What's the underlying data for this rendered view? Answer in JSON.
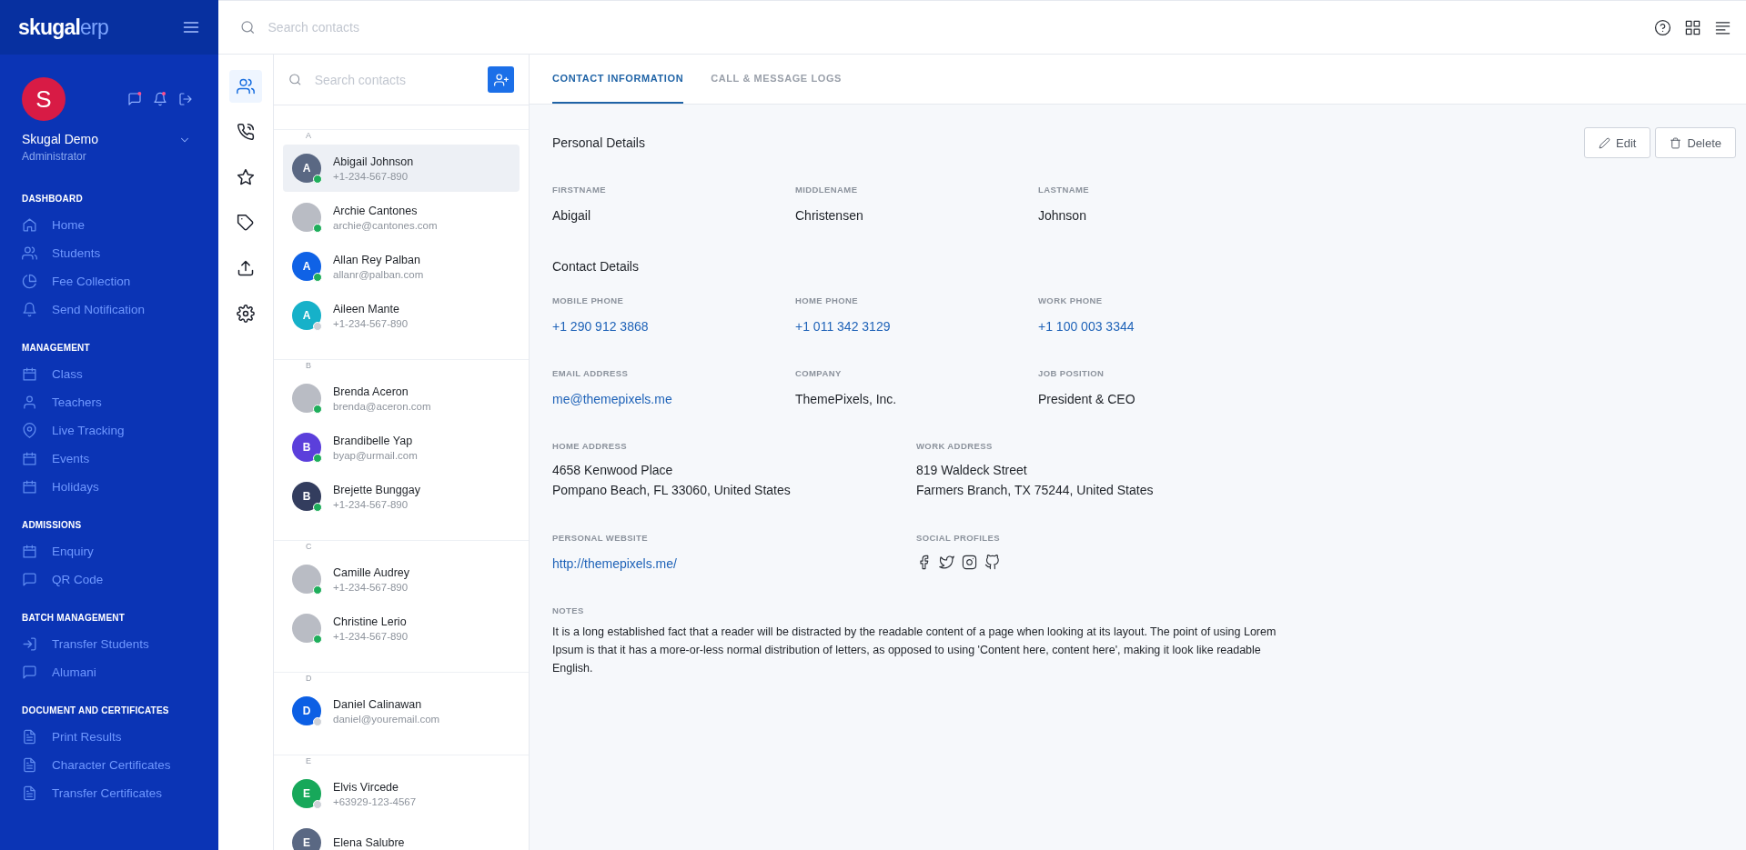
{
  "brand": {
    "logo": "**skugal**erp"
  },
  "user": {
    "initial": "S",
    "name": "Skugal Demo",
    "role": "Administrator"
  },
  "nav": [
    {
      "title": "DASHBOARD",
      "items": [
        "Home",
        "Students",
        "Fee Collection",
        "Send Notification"
      ]
    },
    {
      "title": "MANAGEMENT",
      "items": [
        "Class",
        "Teachers",
        "Live Tracking",
        "Events",
        "Holidays"
      ]
    },
    {
      "title": "ADMISSIONS",
      "items": [
        "Enquiry",
        "QR Code"
      ]
    },
    {
      "title": "BATCH MANAGEMENT",
      "items": [
        "Transfer Students",
        "Alumani"
      ]
    },
    {
      "title": "DOCUMENT AND CERTIFICATES",
      "items": [
        "Print Results",
        "Character Certificates",
        "Transfer Certificates"
      ]
    }
  ],
  "topbar": {
    "search": {
      "placeholder": "Search contacts"
    }
  },
  "rail": [
    {
      "selected": true
    },
    {
      "selected": false
    },
    {
      "selected": false
    },
    {
      "selected": false
    },
    {
      "selected": false
    },
    {
      "selected": false
    }
  ],
  "contacts": {
    "search": {
      "placeholder": "Search contacts"
    },
    "groups": [
      {
        "letter": "A",
        "contacts": [
          {
            "name": "Abigail Johnson",
            "sub": "+1-234-567-890",
            "selected": true,
            "online": true,
            "avatar": {
              "kind": "initial",
              "text": "A",
              "color": "#5a6883"
            }
          },
          {
            "name": "Archie Cantones",
            "sub": "archie@cantones.com",
            "selected": false,
            "online": true,
            "avatar": {
              "kind": "photo"
            }
          },
          {
            "name": "Allan Rey Palban",
            "sub": "allanr@palban.com",
            "selected": false,
            "online": true,
            "avatar": {
              "kind": "initial",
              "text": "A",
              "color": "#0f62e6"
            }
          },
          {
            "name": "Aileen Mante",
            "sub": "+1-234-567-890",
            "selected": false,
            "online": false,
            "avatar": {
              "kind": "initial",
              "text": "A",
              "color": "#16b1c9"
            }
          }
        ]
      },
      {
        "letter": "B",
        "contacts": [
          {
            "name": "Brenda Aceron",
            "sub": "brenda@aceron.com",
            "selected": false,
            "online": true,
            "avatar": {
              "kind": "photo"
            }
          },
          {
            "name": "Brandibelle Yap",
            "sub": "byap@urmail.com",
            "selected": false,
            "online": true,
            "avatar": {
              "kind": "initial",
              "text": "B",
              "color": "#5b3fdb"
            }
          },
          {
            "name": "Brejette Bunggay",
            "sub": "+1-234-567-890",
            "selected": false,
            "online": true,
            "avatar": {
              "kind": "initial",
              "text": "B",
              "color": "#333d5e"
            }
          }
        ]
      },
      {
        "letter": "C",
        "contacts": [
          {
            "name": "Camille Audrey",
            "sub": "+1-234-567-890",
            "selected": false,
            "online": true,
            "avatar": {
              "kind": "photo"
            }
          },
          {
            "name": "Christine Lerio",
            "sub": "+1-234-567-890",
            "selected": false,
            "online": true,
            "avatar": {
              "kind": "photo"
            }
          }
        ]
      },
      {
        "letter": "D",
        "contacts": [
          {
            "name": "Daniel Calinawan",
            "sub": "daniel@youremail.com",
            "selected": false,
            "online": false,
            "avatar": {
              "kind": "initial",
              "text": "D",
              "color": "#0c5fe4"
            }
          }
        ]
      },
      {
        "letter": "E",
        "contacts": [
          {
            "name": "Elvis Vircede",
            "sub": "+63929-123-4567",
            "selected": false,
            "online": false,
            "avatar": {
              "kind": "initial",
              "text": "E",
              "color": "#17a85a"
            }
          },
          {
            "name": "Elena Salubre",
            "selected": false,
            "avatar": {
              "kind": "initial",
              "text": "E",
              "color": "#5a6883"
            }
          }
        ]
      }
    ]
  },
  "detail": {
    "tabs": [
      {
        "label": "CONTACT INFORMATION",
        "selected": true
      },
      {
        "label": "CALL & MESSAGE LOGS",
        "selected": false
      }
    ],
    "buttons": [
      {
        "label": "Edit",
        "kind": "edit"
      },
      {
        "label": "Delete",
        "kind": "delete"
      }
    ],
    "sections": [
      {
        "title": "Personal Details",
        "rows": [
          {
            "fields": [
              {
                "label": "FIRSTNAME",
                "kind": "text",
                "value": "Abigail"
              },
              {
                "label": "MIDDLENAME",
                "kind": "text",
                "value": "Christensen"
              },
              {
                "label": "LASTNAME",
                "kind": "text",
                "value": "Johnson"
              }
            ]
          }
        ]
      },
      {
        "title": "Contact Details",
        "rows": [
          {
            "fields": [
              {
                "label": "MOBILE PHONE",
                "kind": "link",
                "value": "+1 290 912 3868"
              },
              {
                "label": "HOME PHONE",
                "kind": "link",
                "value": "+1 011 342 3129"
              },
              {
                "label": "WORK PHONE",
                "kind": "link",
                "value": "+1 100 003 3344"
              }
            ]
          },
          {
            "fields": [
              {
                "label": "EMAIL ADDRESS",
                "kind": "link",
                "value": "me@themepixels.me"
              },
              {
                "label": "COMPANY",
                "kind": "text",
                "value": "ThemePixels, Inc."
              },
              {
                "label": "JOB POSITION",
                "kind": "text",
                "value": "President & CEO"
              }
            ]
          },
          {
            "fields": [
              {
                "label": "HOME ADDRESS",
                "kind": "lines",
                "lines": [
                  "4658 Kenwood Place",
                  "Pompano Beach, FL 33060, United States"
                ]
              },
              {
                "label": "WORK ADDRESS",
                "kind": "lines",
                "lines": [
                  "819 Waldeck Street",
                  "Farmers Branch, TX 75244, United States"
                ]
              }
            ]
          },
          {
            "fields": [
              {
                "label": "PERSONAL WEBSITE",
                "kind": "link",
                "value": "http://themepixels.me/"
              },
              {
                "label": "SOCIAL PROFILES",
                "kind": "social"
              }
            ]
          },
          {
            "fields": [
              {
                "label": "NOTES",
                "kind": "text",
                "value": "It is a long established fact that a reader will be distracted by the readable content of a page when looking at its layout. The point of using Lorem Ipsum is that it has a more-or-less normal distribution of letters, as opposed to using 'Content here, content here', making it look like readable English."
              }
            ]
          }
        ]
      }
    ]
  }
}
